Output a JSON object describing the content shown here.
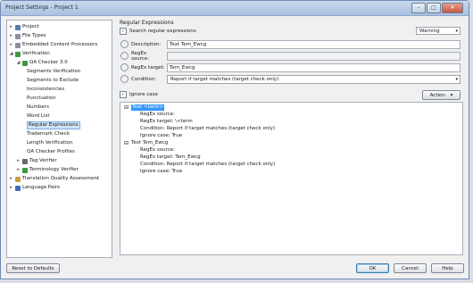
{
  "window": {
    "title": "Project Settings - Project 1",
    "min": "–",
    "max": "□",
    "close": "✕"
  },
  "tree": [
    {
      "label": "Project",
      "exp": "▸",
      "color": "#5b7bb0"
    },
    {
      "label": "File Types",
      "exp": "▸",
      "color": "#8a8f99"
    },
    {
      "label": "Embedded Content Processors",
      "exp": "▸",
      "color": "#8a8f99"
    },
    {
      "label": "Verification",
      "exp": "◢",
      "color": "#3f9a3f"
    },
    {
      "label": "QA Checker 3.0",
      "exp": "◢",
      "color": "#3f9a3f"
    },
    {
      "label": "Segments Verification"
    },
    {
      "label": "Segments to Exclude"
    },
    {
      "label": "Inconsistencies"
    },
    {
      "label": "Punctuation"
    },
    {
      "label": "Numbers"
    },
    {
      "label": "Word List"
    },
    {
      "label": "Regular Expressions"
    },
    {
      "label": "Trademark Check"
    },
    {
      "label": "Length Verification"
    },
    {
      "label": "QA Checker Profiles"
    },
    {
      "label": "Tag Verifier",
      "exp": "▸",
      "color": "#6a6a6a"
    },
    {
      "label": "Terminology Verifier",
      "exp": "▸",
      "color": "#3f9a3f"
    },
    {
      "label": "Translation Quality Assessment",
      "exp": "▸",
      "color": "#c7a23a"
    },
    {
      "label": "Language Pairs",
      "exp": "▸",
      "color": "#3b6fb3"
    }
  ],
  "panel": {
    "title": "Regular Expressions",
    "search_check": "✓",
    "search_label": "Search regular expressions",
    "severity": "Warning",
    "desc_label": "Description:",
    "desc_value": "Text Tem_Ewcg",
    "source_label": "RegEx source:",
    "source_value": "",
    "target_label": "RegEx target:",
    "target_value": "Tem_Ewcg",
    "cond_label": "Condition:",
    "cond_value": "Report if target matches (target check only)",
    "ignore_check": "✓",
    "ignore_label": "Ignore case",
    "action_label": "Action",
    "action_arrow": "▾",
    "dd_arrow": "▾"
  },
  "results": [
    {
      "text": "Text <term>",
      "exp": "⊟",
      "hl": true
    },
    {
      "text": "RegEx source:"
    },
    {
      "text": "RegEx target: \\<term"
    },
    {
      "text": "Condition: Report if target matches (target check only)"
    },
    {
      "text": "Ignore case: True"
    },
    {
      "text": "Text Tem_Ewcg",
      "exp": "⊟"
    },
    {
      "text": "RegEx source:"
    },
    {
      "text": "RegEx target: Tem_Ewcg"
    },
    {
      "text": "Condition: Report if target matches (target check only)"
    },
    {
      "text": "Ignore case: True"
    }
  ],
  "footer": {
    "reset": "Reset to Defaults",
    "ok": "OK",
    "cancel": "Cancel",
    "help": "Help"
  }
}
